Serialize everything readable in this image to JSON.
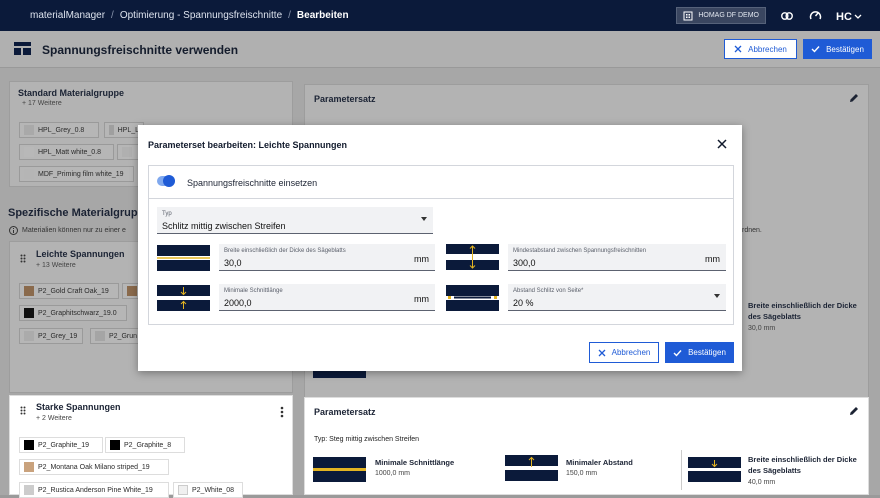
{
  "topbar": {
    "crumbs": [
      "materialManager",
      "Optimierung - Spannungsfreischnitte",
      "Bearbeiten"
    ],
    "demo": "HOMAG DF DEMO"
  },
  "header": {
    "title": "Spannungsfreischnitte verwenden",
    "cancel": "Abbrechen",
    "confirm": "Bestätigen"
  },
  "standard": {
    "title": "Standard Materialgruppe",
    "sub": "+ 17 Weitere",
    "chips": [
      "HPL_Grey_0.8",
      "HPL_L",
      "HPL_Matt white_0.8",
      "MDF_Priming film white_19"
    ]
  },
  "spec": {
    "title": "Spezifische Materialgrup",
    "info": "Materialien können nur zu einer e",
    "info_tail": "rdnen."
  },
  "leicht": {
    "title": "Leichte Spannungen",
    "sub": "+ 13 Weitere",
    "chips": [
      "P2_Gold Craft Oak_19",
      "P2_Graphitschwarz_19.0",
      "P2_Grey_19",
      "P2_Grun"
    ]
  },
  "stark": {
    "title": "Starke Spannungen",
    "sub": "+ 2 Weitere",
    "chips": [
      "P2_Graphite_19",
      "P2_Graphite_8",
      "P2_Montana Oak Milano striped_19",
      "P2_Rustica Anderson Pine White_19",
      "P2_White_08"
    ]
  },
  "param1": {
    "title": "Parametersatz",
    "right_label": "Breite einschließlich der Dicke des Sägeblatts",
    "right_value": "30,0 mm",
    "stub": "30 0"
  },
  "param2": {
    "title": "Parametersatz",
    "typ": "Typ: Steg mittig zwischen Streifen",
    "items": [
      {
        "label": "Minimale Schnittlänge",
        "value": "1000,0 mm"
      },
      {
        "label": "Minimaler Abstand",
        "value": "150,0 mm"
      },
      {
        "label": "Breite einschließlich der Dicke des Sägeblatts",
        "value": "40,0 mm"
      }
    ]
  },
  "modal": {
    "title": "Parameterset bearbeiten: Leichte Spannungen",
    "toggle_label": "Spannungsfreischnitte einsetzen",
    "typ": {
      "label": "Typ",
      "value": "Schlitz mittig zwischen Streifen"
    },
    "f1": {
      "label": "Breite einschließlich der Dicke des Sägeblatts",
      "value": "30,0",
      "unit": "mm"
    },
    "f2": {
      "label": "Mindestabstand zwischen Spannungsfreischnitten",
      "value": "300,0",
      "unit": "mm"
    },
    "f3": {
      "label": "Minimale Schnittlänge",
      "value": "2000,0",
      "unit": "mm"
    },
    "f4": {
      "label": "Abstand Schlitz von Seite*",
      "value": "20 %"
    },
    "cancel": "Abbrechen",
    "confirm": "Bestätigen"
  },
  "colors": {
    "navy": "#0b1a3a",
    "accent": "#1f5bd6",
    "gold": "#e3b422"
  }
}
